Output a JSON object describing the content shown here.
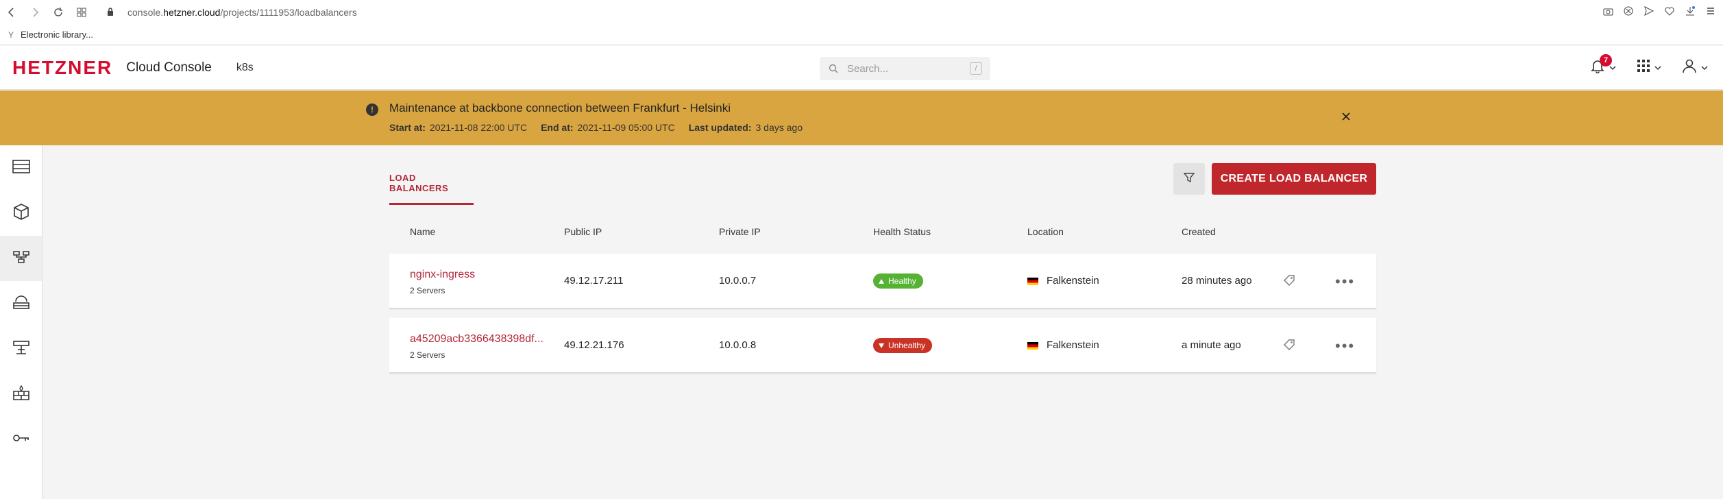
{
  "browser": {
    "url_prefix": "console.",
    "url_domain": "hetzner.cloud",
    "url_path": "/projects/1111953/loadbalancers",
    "bookmark": "Electronic library..."
  },
  "header": {
    "logo": "HETZNER",
    "title": "Cloud Console",
    "project": "k8s",
    "search_placeholder": "Search...",
    "search_shortcut": "/",
    "notification_count": "7"
  },
  "banner": {
    "title": "Maintenance at backbone connection between Frankfurt - Helsinki",
    "start_label": "Start at:",
    "start_value": "2021-11-08 22:00 UTC",
    "end_label": "End at:",
    "end_value": "2021-11-09 05:00 UTC",
    "updated_label": "Last updated:",
    "updated_value": "3 days ago"
  },
  "sidebar": {
    "items": [
      "servers",
      "volumes",
      "load-balancers",
      "floating-ips",
      "networks",
      "firewalls",
      "security"
    ],
    "active": "load-balancers"
  },
  "main": {
    "tab": "LOAD BALANCERS",
    "create_label": "CREATE LOAD BALANCER",
    "columns": [
      "Name",
      "Public IP",
      "Private IP",
      "Health Status",
      "Location",
      "Created"
    ],
    "rows": [
      {
        "name": "nginx-ingress",
        "servers": "2 Servers",
        "public_ip": "49.12.17.211",
        "private_ip": "10.0.0.7",
        "health": "Healthy",
        "location": "Falkenstein",
        "created": "28 minutes ago"
      },
      {
        "name": "a45209acb3366438398df...",
        "servers": "2 Servers",
        "public_ip": "49.12.21.176",
        "private_ip": "10.0.0.8",
        "health": "Unhealthy",
        "location": "Falkenstein",
        "created": "a minute ago"
      }
    ]
  },
  "colors": {
    "brand_red": "#d50c2d",
    "accent_red": "#c0272d",
    "banner": "#d9a540",
    "healthy": "#56b233",
    "unhealthy": "#c93225"
  }
}
